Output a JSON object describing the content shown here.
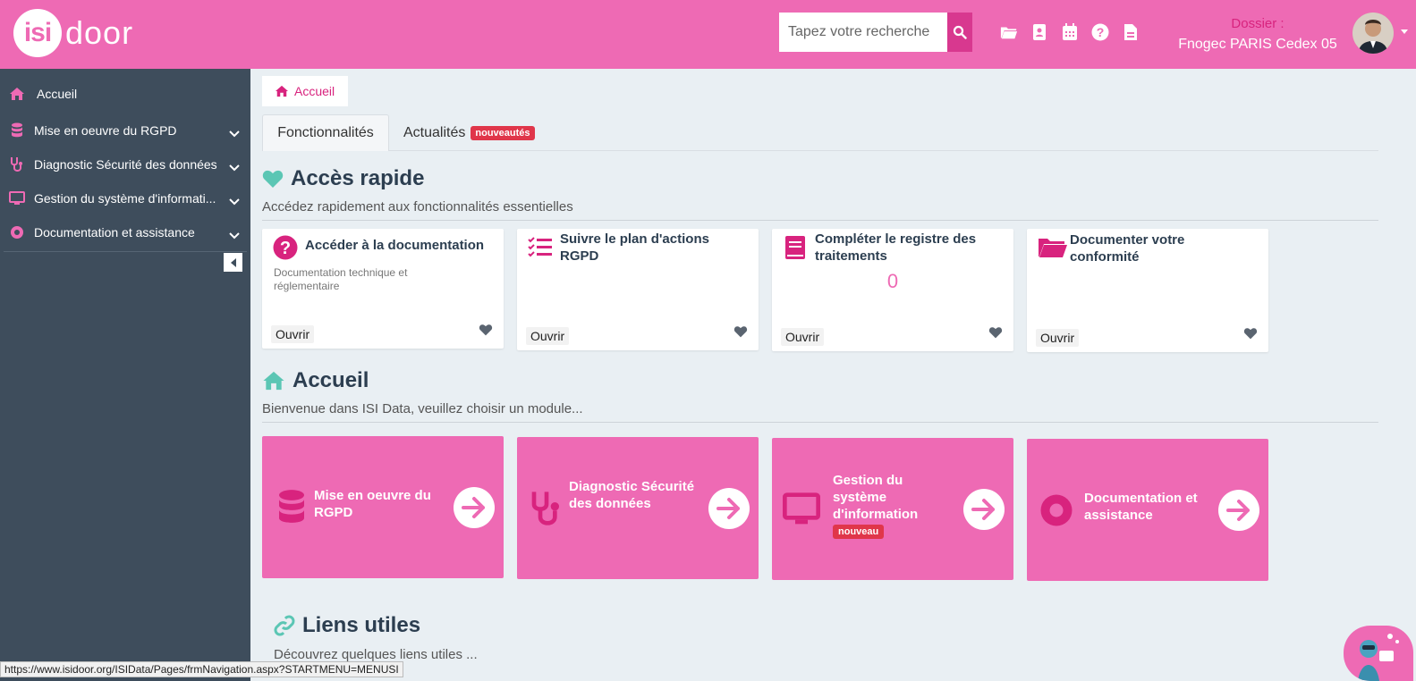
{
  "app": {
    "logo_left": "isi",
    "logo_right": "door"
  },
  "header": {
    "search_placeholder": "Tapez votre recherche",
    "dossier_label": "Dossier :",
    "dossier_value": "Fnogec PARIS Cedex 05",
    "icons": [
      "folder-icon",
      "contact-card-icon",
      "calendar-icon",
      "help-icon",
      "document-icon"
    ]
  },
  "sidebar": {
    "items": [
      {
        "label": "Accueil",
        "icon": "home-icon"
      },
      {
        "label": "Mise en oeuvre du RGPD",
        "icon": "database-icon"
      },
      {
        "label": "Diagnostic Sécurité des données",
        "icon": "stethoscope-icon"
      },
      {
        "label": "Gestion du système d'informati...",
        "icon": "monitor-icon"
      },
      {
        "label": "Documentation et assistance",
        "icon": "lifebuoy-icon"
      }
    ]
  },
  "breadcrumb": {
    "label": "Accueil"
  },
  "tabs": [
    {
      "label": "Fonctionnalités"
    },
    {
      "label": "Actualités",
      "badge": "nouveautés"
    }
  ],
  "quick_access": {
    "title": "Accès rapide",
    "subtitle": "Accédez rapidement aux fonctionnalités essentielles",
    "cards": [
      {
        "title": "Accéder à la documentation",
        "desc": "Documentation technique et réglementaire",
        "open": "Ouvrir"
      },
      {
        "title": "Suivre le plan d'actions RGPD",
        "open": "Ouvrir"
      },
      {
        "title": "Compléter le registre des traitements",
        "count": "0",
        "open": "Ouvrir"
      },
      {
        "title": "Documenter votre conformité",
        "open": "Ouvrir"
      }
    ]
  },
  "home": {
    "title": "Accueil",
    "subtitle": "Bienvenue dans ISI Data, veuillez choisir un module...",
    "modules": [
      {
        "label": "Mise en oeuvre du RGPD"
      },
      {
        "label": "Diagnostic Sécurité des données"
      },
      {
        "label": "Gestion du système d'information",
        "badge": "nouveau"
      },
      {
        "label": "Documentation et assistance"
      }
    ]
  },
  "links": {
    "title": "Liens utiles",
    "subtitle": "Découvrez quelques liens utiles ..."
  },
  "status_url": "https://www.isidoor.org/ISIData/Pages/frmNavigation.aspx?STARTMENU=MENUSI",
  "colors": {
    "brand_pink": "#ee6ab4",
    "sidebar": "#3e4d5c",
    "accent_teal": "#5bc6b4",
    "badge_red": "#e0364a"
  }
}
